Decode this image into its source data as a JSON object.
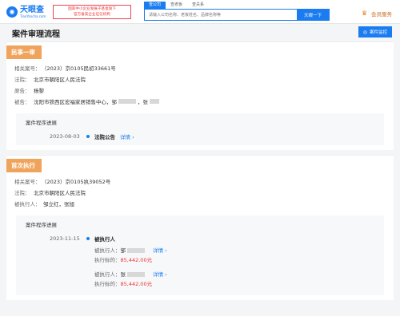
{
  "header": {
    "logo_cn": "天眼查",
    "logo_en": "TianYancha.com",
    "banner_line1": "国家中小企业发展子基金旗下",
    "banner_line2": "官方备案企业征信机构",
    "tabs": [
      "查公司",
      "查老板",
      "查关系"
    ],
    "search_placeholder": "请输入公司名称、老板姓名、品牌名称等",
    "search_button": "天眼一下",
    "vip_label": "会员服务"
  },
  "page": {
    "title": "案件审理流程",
    "monitor_button": "案件监控"
  },
  "first_trial": {
    "tag": "民事一审",
    "case_no_label": "相关案号：",
    "case_no": "（2023）京0105民初33661号",
    "court_label": "法院：",
    "court": "北京市朝阳区人民法院",
    "plaintiff_label": "原告：",
    "plaintiff": "杨黎",
    "defendant_label": "被告：",
    "defendant_company": "沈阳市铁西区宏福家居销售中心",
    "defendant_sep": "，",
    "defendant_p1": "邹",
    "defendant_p2": "，张",
    "progress_title": "案件程序进展",
    "progress": {
      "date": "2023-08-03",
      "item": "法院公告",
      "link": "详情"
    }
  },
  "execution": {
    "tag": "首次执行",
    "case_no_label": "相关案号：",
    "case_no": "（2023）京0105执39052号",
    "court_label": "法院：",
    "court": "北京市朝阳区人民法院",
    "executed_label": "被执行人：",
    "executed": "邹立红，张旭",
    "progress_title": "案件程序进展",
    "progress": {
      "date": "2023-11-15",
      "item": "被执行人"
    },
    "details": [
      {
        "person_label": "被执行人：",
        "person": "邹",
        "link": "详情",
        "amount_label": "执行标的：",
        "amount": "85,442.00元"
      },
      {
        "person_label": "被执行人：",
        "person": "张",
        "link": "详情",
        "amount_label": "执行标的：",
        "amount": "85,442.00元"
      }
    ]
  }
}
